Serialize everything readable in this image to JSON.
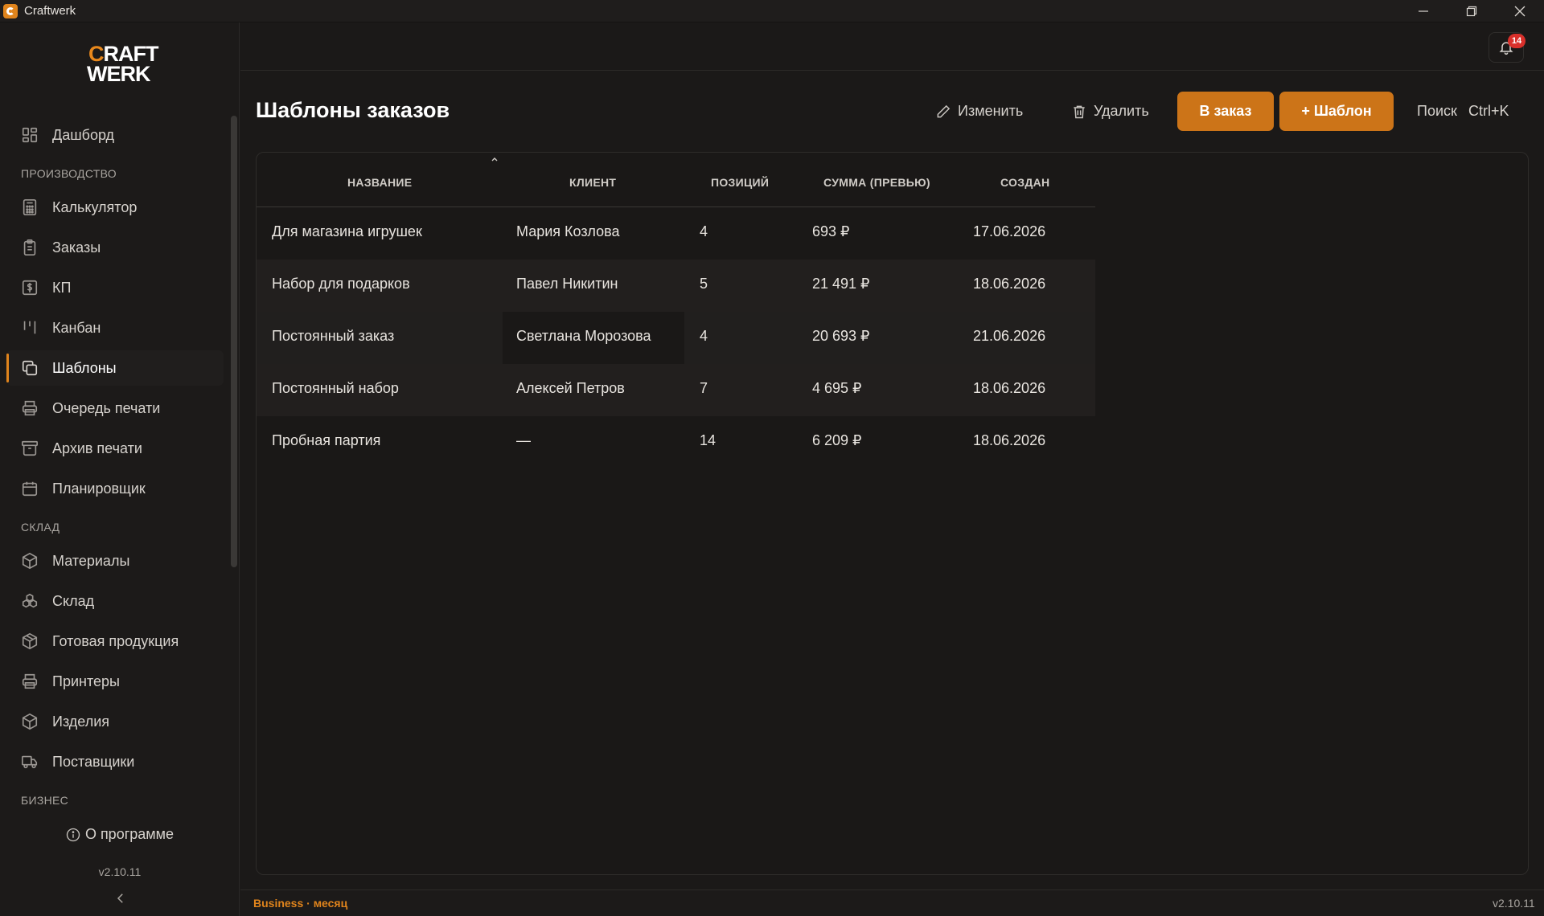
{
  "window": {
    "title": "Craftwerk"
  },
  "logo": {
    "line1_accent": "C",
    "line1_rest": "RAFT",
    "line2": "WERK"
  },
  "sidebar": {
    "dashboard": "Дашборд",
    "sections": {
      "production": "ПРОИЗВОДСТВО",
      "warehouse": "СКЛАД",
      "business": "БИЗНЕС"
    },
    "production_items": [
      {
        "label": "Калькулятор",
        "icon": "calculator-icon"
      },
      {
        "label": "Заказы",
        "icon": "clipboard-icon"
      },
      {
        "label": "КП",
        "icon": "invoice-icon"
      },
      {
        "label": "Канбан",
        "icon": "kanban-icon"
      },
      {
        "label": "Шаблоны",
        "icon": "copy-icon",
        "active": true
      },
      {
        "label": "Очередь печати",
        "icon": "printer-icon"
      },
      {
        "label": "Архив печати",
        "icon": "archive-icon"
      },
      {
        "label": "Планировщик",
        "icon": "calendar-icon"
      }
    ],
    "warehouse_items": [
      {
        "label": "Материалы",
        "icon": "box-icon"
      },
      {
        "label": "Склад",
        "icon": "boxes-icon"
      },
      {
        "label": "Готовая продукция",
        "icon": "package-icon"
      },
      {
        "label": "Принтеры",
        "icon": "printer-icon"
      },
      {
        "label": "Изделия",
        "icon": "box-icon"
      },
      {
        "label": "Поставщики",
        "icon": "truck-icon"
      }
    ],
    "about": "О программе",
    "version": "v2.10.11"
  },
  "topbar": {
    "notifications_count": "14"
  },
  "header": {
    "title": "Шаблоны заказов",
    "edit_label": "Изменить",
    "delete_label": "Удалить",
    "to_order_label": "В заказ",
    "add_template_label": "+ Шаблон",
    "search_label": "Поиск",
    "search_shortcut": "Ctrl+K"
  },
  "table": {
    "columns": [
      "НАЗВАНИЕ",
      "КЛИЕНТ",
      "ПОЗИЦИЙ",
      "СУММА (ПРЕВЬЮ)",
      "СОЗДАН"
    ],
    "sort": {
      "column": "НАЗВАНИЕ",
      "direction": "asc"
    },
    "rows": [
      {
        "name": "Для магазина игрушек",
        "client": "Мария Козлова",
        "positions": "4",
        "sum": "693 ₽",
        "created": "17.06.2026"
      },
      {
        "name": "Набор для подарков",
        "client": "Павел Никитин",
        "positions": "5",
        "sum": "21 491 ₽",
        "created": "18.06.2026"
      },
      {
        "name": "Постоянный заказ",
        "client": "Светлана Морозова",
        "positions": "4",
        "sum": "20 693 ₽",
        "created": "21.06.2026"
      },
      {
        "name": "Постоянный набор",
        "client": "Алексей Петров",
        "positions": "7",
        "sum": "4 695 ₽",
        "created": "18.06.2026"
      },
      {
        "name": "Пробная партия",
        "client": "—",
        "positions": "14",
        "sum": "6 209 ₽",
        "created": "18.06.2026"
      }
    ]
  },
  "statusbar": {
    "plan": "Business · месяц",
    "version": "v2.10.11"
  },
  "colors": {
    "accent": "#cc7418",
    "badge": "#d9302b",
    "background": "#1b1918"
  }
}
